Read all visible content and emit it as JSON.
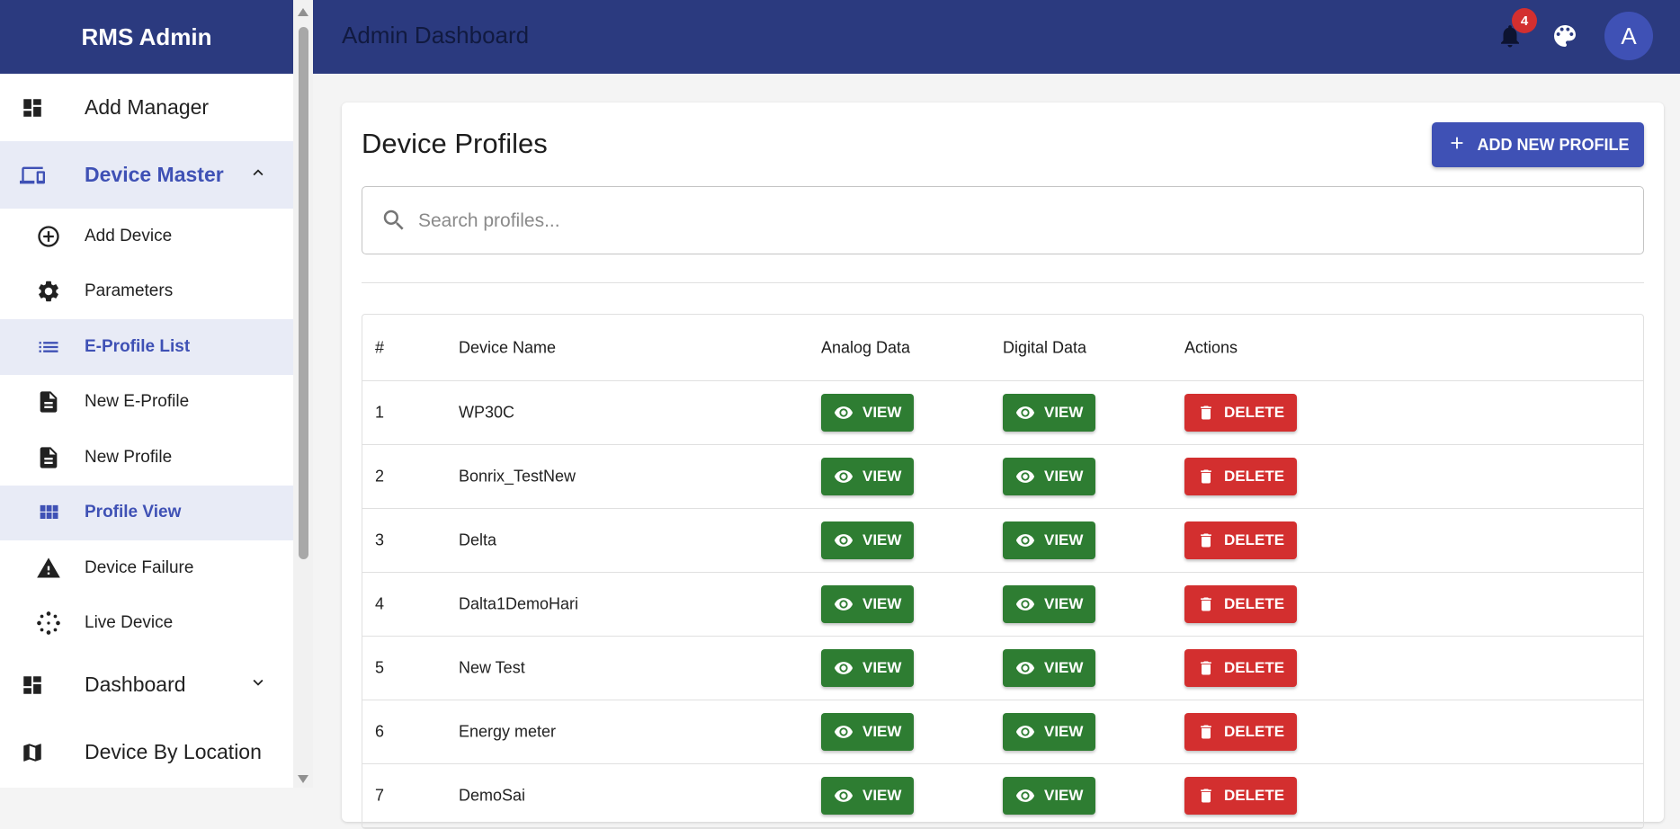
{
  "sidebar": {
    "brand": "RMS Admin",
    "items": [
      {
        "label": "Add Manager",
        "icon": "dashboard-icon"
      },
      {
        "label": "Device Master",
        "icon": "devices-icon"
      },
      {
        "label": "Add Device",
        "icon": "add-circle-icon"
      },
      {
        "label": "Parameters",
        "icon": "gear-icon"
      },
      {
        "label": "E-Profile List",
        "icon": "list-icon"
      },
      {
        "label": "New E-Profile",
        "icon": "document-icon"
      },
      {
        "label": "New Profile",
        "icon": "document-icon"
      },
      {
        "label": "Profile View",
        "icon": "grid-icon"
      },
      {
        "label": "Device Failure",
        "icon": "warning-icon"
      },
      {
        "label": "Live Device",
        "icon": "live-icon"
      },
      {
        "label": "Dashboard",
        "icon": "dashboard-icon"
      },
      {
        "label": "Device By Location",
        "icon": "map-icon"
      }
    ]
  },
  "header": {
    "title": "Admin Dashboard",
    "notification_count": "4",
    "avatar_initial": "A"
  },
  "main": {
    "title": "Device Profiles",
    "add_button": "ADD NEW PROFILE",
    "search_placeholder": "Search profiles...",
    "table": {
      "columns": [
        "#",
        "Device Name",
        "Analog Data",
        "Digital Data",
        "Actions"
      ],
      "view_label": "VIEW",
      "delete_label": "DELETE",
      "rows": [
        {
          "num": "1",
          "name": "WP30C"
        },
        {
          "num": "2",
          "name": "Bonrix_TestNew"
        },
        {
          "num": "3",
          "name": "Delta"
        },
        {
          "num": "4",
          "name": "Dalta1DemoHari"
        },
        {
          "num": "5",
          "name": "New Test"
        },
        {
          "num": "6",
          "name": "Energy meter"
        },
        {
          "num": "7",
          "name": "DemoSai"
        }
      ]
    }
  },
  "colors": {
    "primary": "#2b3a7f",
    "accent": "#3f51b5",
    "view": "#2e7d32",
    "delete": "#d32f2f"
  }
}
